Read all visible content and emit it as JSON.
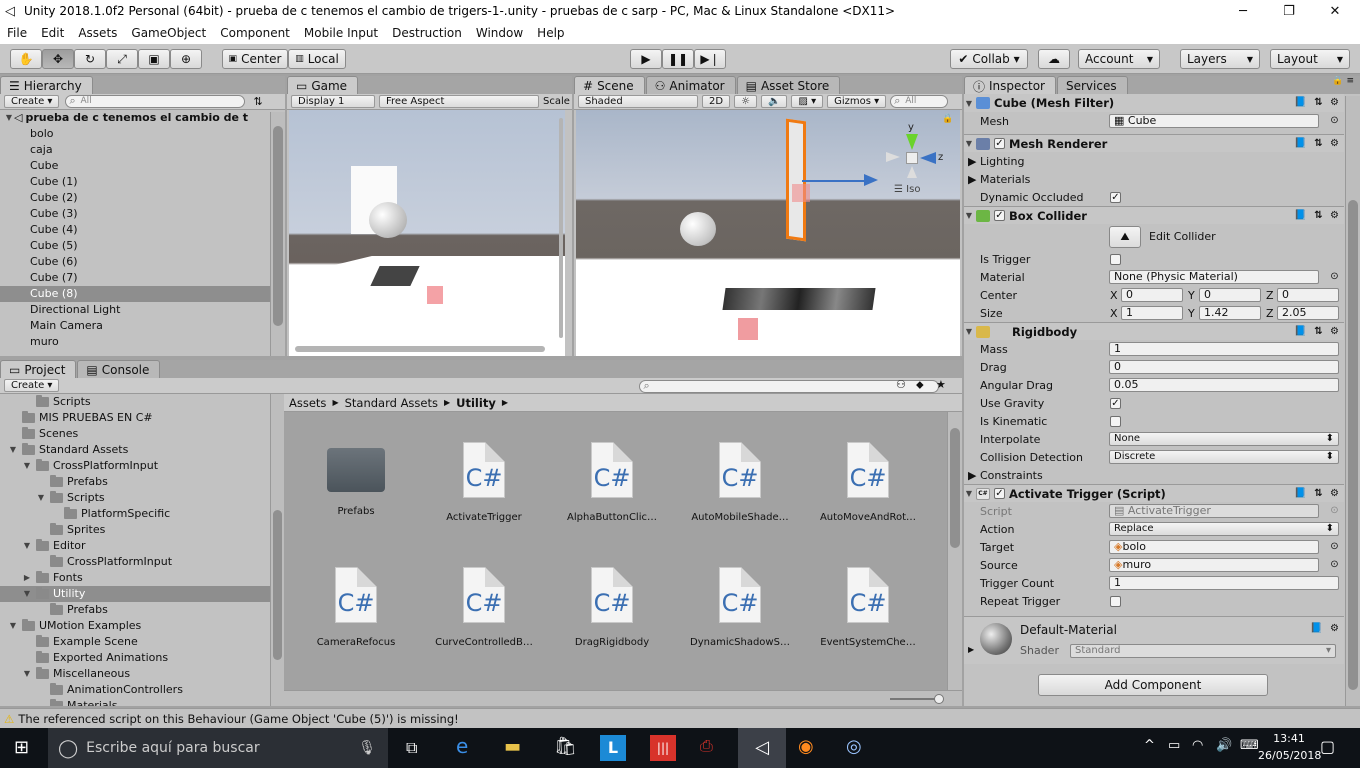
{
  "window": {
    "title": "Unity 2018.1.0f2 Personal (64bit) - prueba de c tenemos el cambio de trigers-1-.unity - pruebas de  c sarp - PC, Mac & Linux Standalone <DX11>",
    "minimize": "─",
    "maximize": "❐",
    "close": "✕"
  },
  "menu": [
    "File",
    "Edit",
    "Assets",
    "GameObject",
    "Component",
    "Mobile Input",
    "Destruction",
    "Window",
    "Help"
  ],
  "toolbar": {
    "pivot": "Center",
    "space": "Local",
    "collab": "Collab ▾",
    "account": "Account",
    "layers": "Layers",
    "layout": "Layout"
  },
  "hierarchy": {
    "tab": "Hierarchy",
    "create": "Create",
    "search_placeholder": "All",
    "scene": "prueba de c tenemos el cambio de t",
    "items": [
      "bolo",
      "caja",
      "Cube",
      "Cube (1)",
      "Cube (2)",
      "Cube (3)",
      "Cube (4)",
      "Cube (5)",
      "Cube (6)",
      "Cube (7)",
      "Cube (8)",
      "Directional Light",
      "Main Camera",
      "muro"
    ],
    "selected_index": 10
  },
  "game": {
    "tab": "Game",
    "display": "Display 1",
    "aspect": "Free Aspect",
    "scale": "Scale"
  },
  "scene_view": {
    "tabs": [
      "Scene",
      "Animator",
      "Asset Store"
    ],
    "shading": "Shaded",
    "mode2d": "2D",
    "gizmos": "Gizmos",
    "search_placeholder": "All",
    "iso": "Iso",
    "axis_y": "y",
    "axis_z": "z"
  },
  "project": {
    "tabs": [
      "Project",
      "Console"
    ],
    "create": "Create",
    "breadcrumb": [
      "Assets",
      "Standard Assets",
      "Utility"
    ],
    "tree": [
      {
        "label": "Scripts",
        "depth": 2,
        "fold": ""
      },
      {
        "label": "MIS PRUEBAS EN C#",
        "depth": 1,
        "fold": ""
      },
      {
        "label": "Scenes",
        "depth": 1,
        "fold": ""
      },
      {
        "label": "Standard Assets",
        "depth": 1,
        "fold": "▼"
      },
      {
        "label": "CrossPlatformInput",
        "depth": 2,
        "fold": "▼"
      },
      {
        "label": "Prefabs",
        "depth": 3,
        "fold": ""
      },
      {
        "label": "Scripts",
        "depth": 3,
        "fold": "▼"
      },
      {
        "label": "PlatformSpecific",
        "depth": 4,
        "fold": ""
      },
      {
        "label": "Sprites",
        "depth": 3,
        "fold": ""
      },
      {
        "label": "Editor",
        "depth": 2,
        "fold": "▼"
      },
      {
        "label": "CrossPlatformInput",
        "depth": 3,
        "fold": ""
      },
      {
        "label": "Fonts",
        "depth": 2,
        "fold": "▶"
      },
      {
        "label": "Utility",
        "depth": 2,
        "fold": "▼",
        "selected": true
      },
      {
        "label": "Prefabs",
        "depth": 3,
        "fold": ""
      },
      {
        "label": "UMotion Examples",
        "depth": 1,
        "fold": "▼"
      },
      {
        "label": "Example Scene",
        "depth": 2,
        "fold": ""
      },
      {
        "label": "Exported Animations",
        "depth": 2,
        "fold": ""
      },
      {
        "label": "Miscellaneous",
        "depth": 2,
        "fold": "▼"
      },
      {
        "label": "AnimationControllers",
        "depth": 3,
        "fold": ""
      },
      {
        "label": "Materials",
        "depth": 3,
        "fold": ""
      }
    ],
    "assets_row1": [
      {
        "name": "Prefabs",
        "kind": "folder"
      },
      {
        "name": "ActivateTrigger",
        "kind": "cs"
      },
      {
        "name": "AlphaButtonClic…",
        "kind": "cs"
      },
      {
        "name": "AutoMobileShade…",
        "kind": "cs"
      },
      {
        "name": "AutoMoveAndRot…",
        "kind": "cs"
      }
    ],
    "assets_row2": [
      {
        "name": "CameraRefocus",
        "kind": "cs"
      },
      {
        "name": "CurveControlledB…",
        "kind": "cs"
      },
      {
        "name": "DragRigidbody",
        "kind": "cs"
      },
      {
        "name": "DynamicShadowS…",
        "kind": "cs"
      },
      {
        "name": "EventSystemChe…",
        "kind": "cs"
      }
    ],
    "cs_glyph": "C#"
  },
  "inspector": {
    "tabs": [
      "Inspector",
      "Services"
    ],
    "mesh_filter": {
      "title": "Cube (Mesh Filter)",
      "mesh_label": "Mesh",
      "mesh_value": "Cube"
    },
    "mesh_renderer": {
      "title": "Mesh Renderer",
      "lighting": "Lighting",
      "materials": "Materials",
      "dynamic_occluded": "Dynamic Occluded"
    },
    "box_collider": {
      "title": "Box Collider",
      "edit": "Edit Collider",
      "is_trigger": "Is Trigger",
      "material_label": "Material",
      "material_value": "None (Physic Material)",
      "center_label": "Center",
      "center": {
        "x": "0",
        "y": "0",
        "z": "0"
      },
      "size_label": "Size",
      "size": {
        "x": "1",
        "y": "1.42",
        "z": "2.05"
      }
    },
    "rigidbody": {
      "title": "Rigidbody",
      "mass_label": "Mass",
      "mass": "1",
      "drag_label": "Drag",
      "drag": "0",
      "angular_label": "Angular Drag",
      "angular": "0.05",
      "gravity_label": "Use Gravity",
      "kinematic_label": "Is Kinematic",
      "interpolate_label": "Interpolate",
      "interpolate": "None",
      "collision_label": "Collision Detection",
      "collision": "Discrete",
      "constraints": "Constraints"
    },
    "activate_trigger": {
      "title": "Activate Trigger (Script)",
      "script_label": "Script",
      "script": "ActivateTrigger",
      "action_label": "Action",
      "action": "Replace",
      "target_label": "Target",
      "target": "bolo",
      "source_label": "Source",
      "source": "muro",
      "count_label": "Trigger Count",
      "count": "1",
      "repeat_label": "Repeat Trigger"
    },
    "material": {
      "name": "Default-Material",
      "shader_label": "Shader",
      "shader": "Standard"
    },
    "add_component": "Add Component",
    "xyz": {
      "x": "X",
      "y": "Y",
      "z": "Z"
    }
  },
  "status": {
    "message": "The referenced script on this Behaviour (Game Object 'Cube (5)') is missing!"
  },
  "taskbar": {
    "search": "Escribe aquí para buscar",
    "time": "13:41",
    "date": "26/05/2018"
  },
  "colors": {
    "accent": "#3a72c4",
    "warning": "#e8b400",
    "selection": "#8e8e8e"
  }
}
